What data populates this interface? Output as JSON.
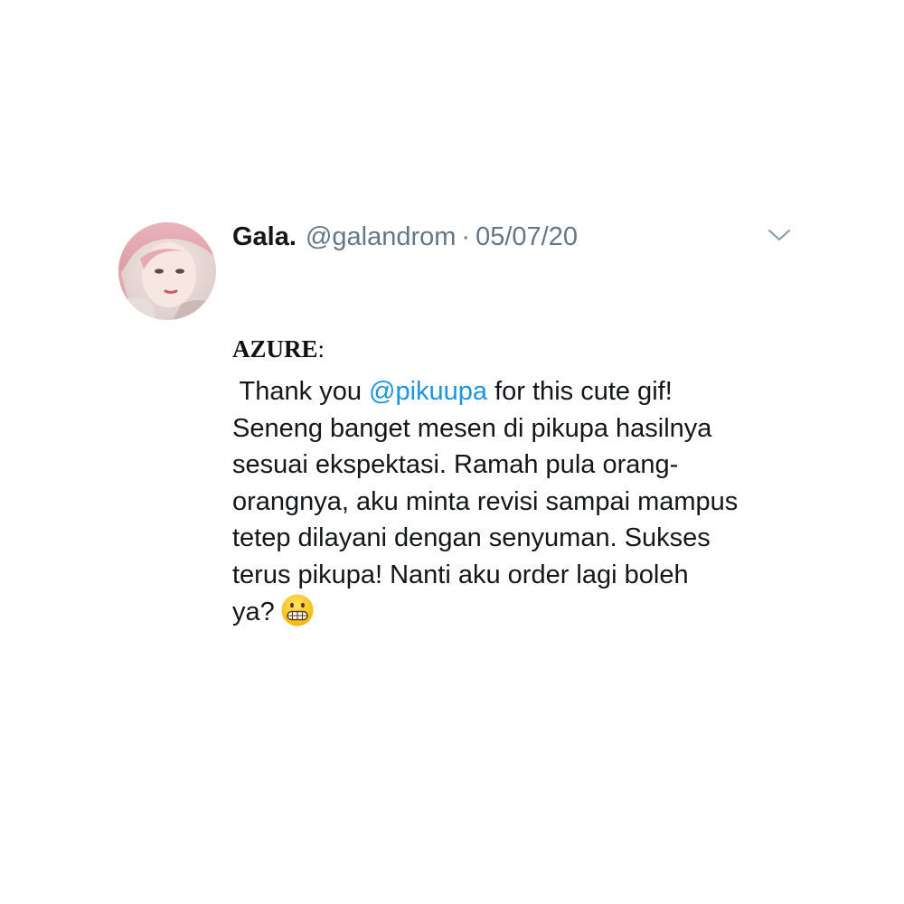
{
  "tweet": {
    "display_name": "Gala.",
    "handle": "@galandrom",
    "separator": "·",
    "date": "05/07/20",
    "avatar_icon": "profile-photo-avatar",
    "menu_icon": "chevron-down-icon"
  },
  "label": {
    "text": "AZURE",
    "colon": ":"
  },
  "body": {
    "line1_prefix": " Thank you ",
    "mention": "@pikuupa",
    "line1_suffix": " for this cute gif!",
    "line2": "Seneng banget mesen di pikupa hasilnya",
    "line3": "sesuai ekspektasi. Ramah pula orang-",
    "line4": "orangnya, aku minta revisi sampai mampus",
    "line5": "tetep dilayani dengan senyuman. Sukses",
    "line6": "terus pikupa! Nanti aku order lagi boleh",
    "line7": "ya?",
    "emoji_icon": "grimacing-face-emoji-icon"
  },
  "colors": {
    "mention": "#1b95e0",
    "secondary_text": "#657786",
    "primary_text": "#14171a",
    "background": "#ffffff"
  }
}
